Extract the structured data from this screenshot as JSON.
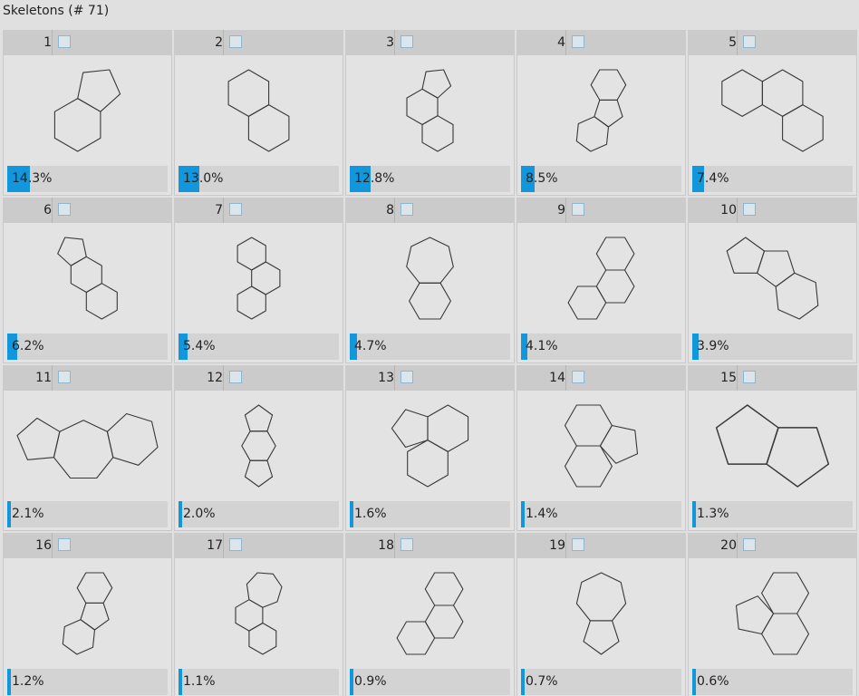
{
  "panel": {
    "title": "Skeletons (# 71)"
  },
  "colors": {
    "bar_fill": "#1296dc",
    "cell_bg": "#e3e3e3",
    "header_bg": "#cbcbcb",
    "stroke": "#383838"
  },
  "skeletons": [
    {
      "index": "1",
      "fraction": 0.143,
      "percent_label": "14.3%"
    },
    {
      "index": "2",
      "fraction": 0.13,
      "percent_label": "13.0%"
    },
    {
      "index": "3",
      "fraction": 0.128,
      "percent_label": "12.8%"
    },
    {
      "index": "4",
      "fraction": 0.085,
      "percent_label": "8.5%"
    },
    {
      "index": "5",
      "fraction": 0.074,
      "percent_label": "7.4%"
    },
    {
      "index": "6",
      "fraction": 0.062,
      "percent_label": "6.2%"
    },
    {
      "index": "7",
      "fraction": 0.054,
      "percent_label": "5.4%"
    },
    {
      "index": "8",
      "fraction": 0.047,
      "percent_label": "4.7%"
    },
    {
      "index": "9",
      "fraction": 0.041,
      "percent_label": "4.1%"
    },
    {
      "index": "10",
      "fraction": 0.039,
      "percent_label": "3.9%"
    },
    {
      "index": "11",
      "fraction": 0.021,
      "percent_label": "2.1%"
    },
    {
      "index": "12",
      "fraction": 0.02,
      "percent_label": "2.0%"
    },
    {
      "index": "13",
      "fraction": 0.016,
      "percent_label": "1.6%"
    },
    {
      "index": "14",
      "fraction": 0.014,
      "percent_label": "1.4%"
    },
    {
      "index": "15",
      "fraction": 0.013,
      "percent_label": "1.3%"
    },
    {
      "index": "16",
      "fraction": 0.012,
      "percent_label": "1.2%"
    },
    {
      "index": "17",
      "fraction": 0.011,
      "percent_label": "1.1%"
    },
    {
      "index": "18",
      "fraction": 0.009,
      "percent_label": "0.9%"
    },
    {
      "index": "19",
      "fraction": 0.007,
      "percent_label": "0.7%"
    },
    {
      "index": "20",
      "fraction": 0.006,
      "percent_label": "0.6%"
    }
  ]
}
